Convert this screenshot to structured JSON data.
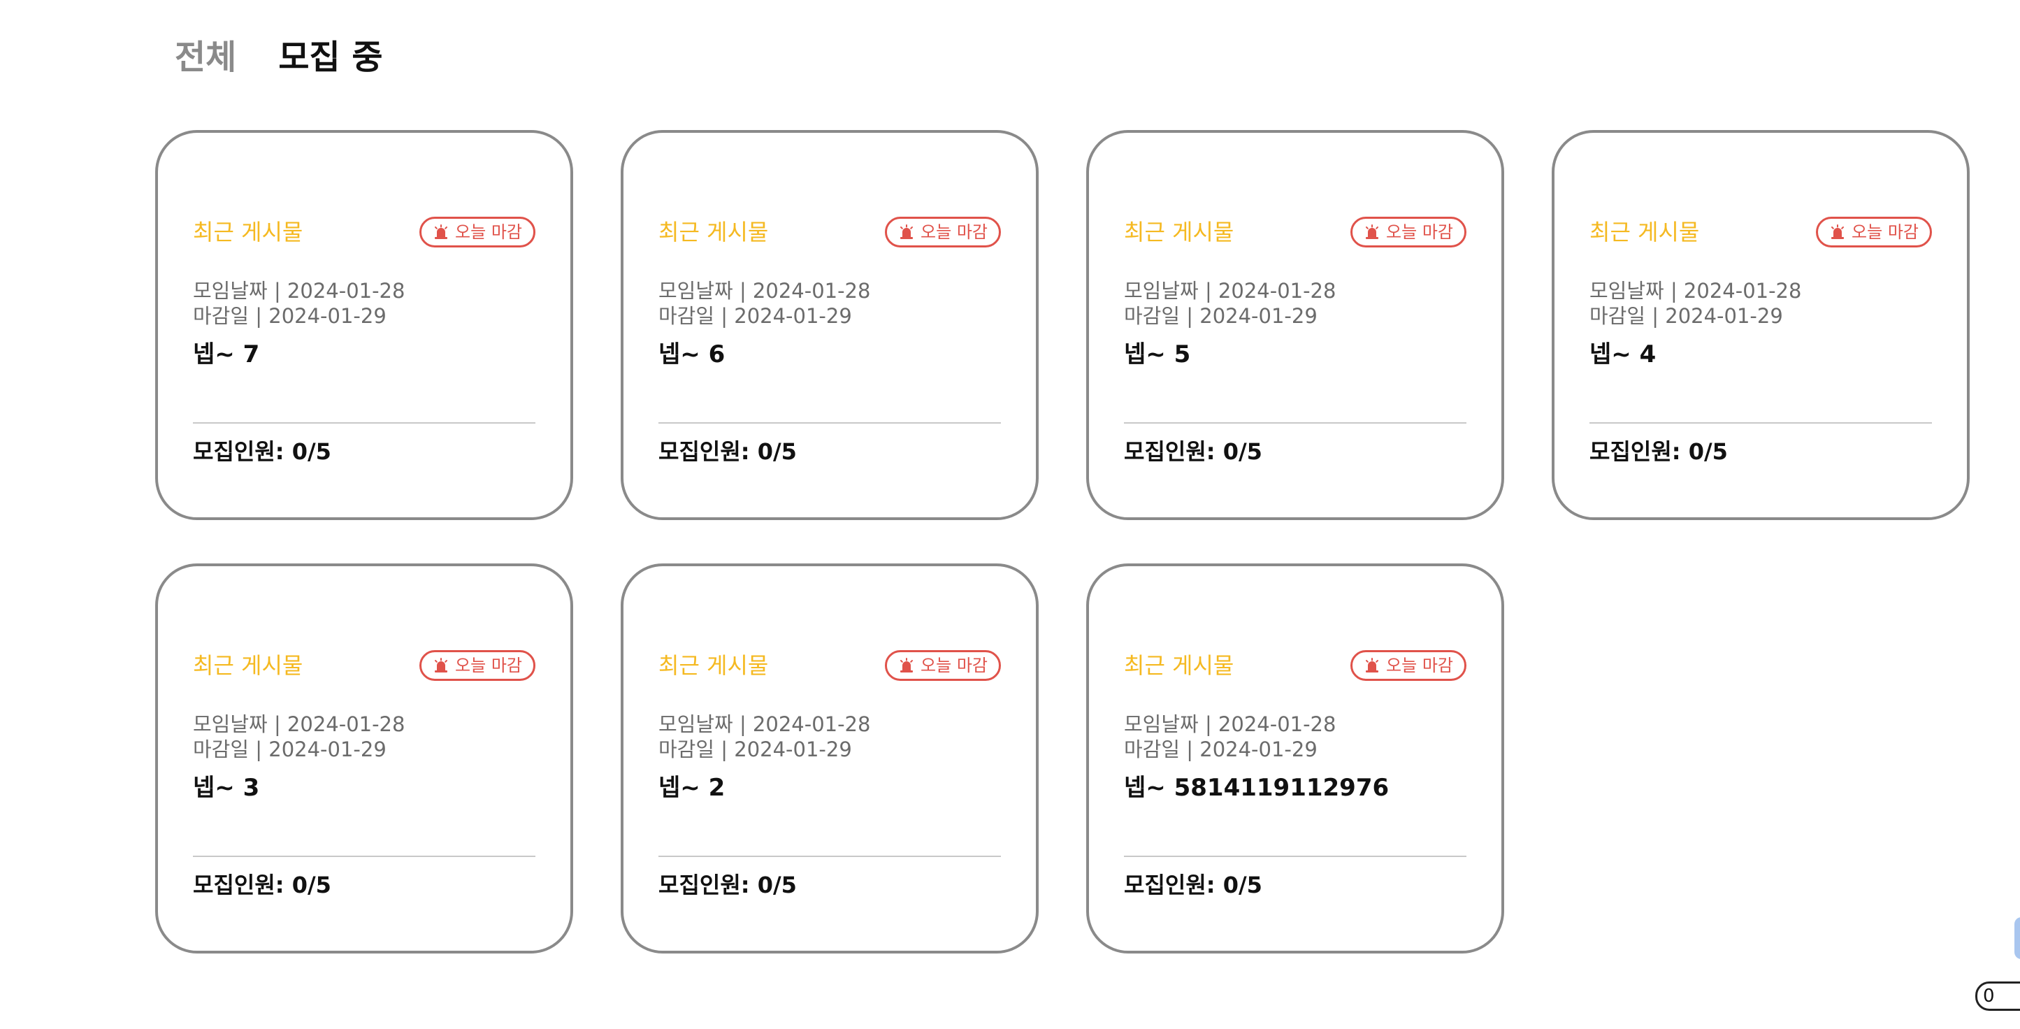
{
  "tabs": [
    {
      "label": "전체",
      "active": false
    },
    {
      "label": "모집 중",
      "active": true
    }
  ],
  "colors": {
    "recent_label": "#f5b921",
    "deadline_badge": "#e0524a",
    "card_border": "#8a8a8a",
    "tab_inactive": "#8a8a8a",
    "tab_active": "#111111"
  },
  "cards": [
    {
      "recent_label": "최근 게시물",
      "badge_label": "오늘 마감",
      "badge_icon": "alarm-icon",
      "meeting_date": "모임날짜 | 2024-01-28",
      "deadline_date": "마감일 | 2024-01-29",
      "title": "넵~ 7",
      "members": "모집인원:  0/5"
    },
    {
      "recent_label": "최근 게시물",
      "badge_label": "오늘 마감",
      "badge_icon": "alarm-icon",
      "meeting_date": "모임날짜 | 2024-01-28",
      "deadline_date": "마감일 | 2024-01-29",
      "title": "넵~ 6",
      "members": "모집인원:  0/5"
    },
    {
      "recent_label": "최근 게시물",
      "badge_label": "오늘 마감",
      "badge_icon": "alarm-icon",
      "meeting_date": "모임날짜 | 2024-01-28",
      "deadline_date": "마감일 | 2024-01-29",
      "title": "넵~ 5",
      "members": "모집인원:  0/5"
    },
    {
      "recent_label": "최근 게시물",
      "badge_label": "오늘 마감",
      "badge_icon": "alarm-icon",
      "meeting_date": "모임날짜 | 2024-01-28",
      "deadline_date": "마감일 | 2024-01-29",
      "title": "넵~ 4",
      "members": "모집인원:  0/5"
    },
    {
      "recent_label": "최근 게시물",
      "badge_label": "오늘 마감",
      "badge_icon": "alarm-icon",
      "meeting_date": "모임날짜 | 2024-01-28",
      "deadline_date": "마감일 | 2024-01-29",
      "title": "넵~ 3",
      "members": "모집인원:  0/5"
    },
    {
      "recent_label": "최근 게시물",
      "badge_label": "오늘 마감",
      "badge_icon": "alarm-icon",
      "meeting_date": "모임날짜 | 2024-01-28",
      "deadline_date": "마감일 | 2024-01-29",
      "title": "넵~ 2",
      "members": "모집인원:  0/5"
    },
    {
      "recent_label": "최근 게시물",
      "badge_label": "오늘 마감",
      "badge_icon": "alarm-icon",
      "meeting_date": "모임날짜 | 2024-01-28",
      "deadline_date": "마감일 | 2024-01-29",
      "title": "넵~ 5814119112976",
      "members": "모집인원:  0/5"
    }
  ],
  "corner_input": {
    "value": "0"
  }
}
